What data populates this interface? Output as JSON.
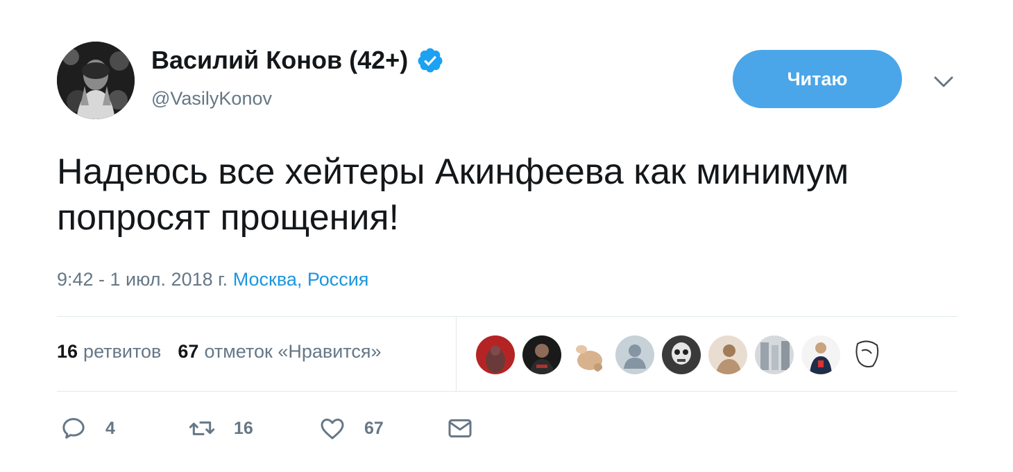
{
  "tweet": {
    "author_name": "Василий Конов (42+)",
    "author_handle": "@VasilyKonov",
    "follow_label": "Читаю",
    "text": "Надеюсь все хейтеры Акинфеева как минимум попросят прощения!",
    "timestamp": "9:42 - 1 июл. 2018 г.",
    "location": "Москва, Россия"
  },
  "stats": {
    "retweets_count": "16",
    "retweets_label": "ретвитов",
    "likes_count": "67",
    "likes_label": "отметок «Нравится»"
  },
  "actions": {
    "reply_count": "4",
    "retweet_count": "16",
    "like_count": "67"
  },
  "icons": {
    "verified": "verified-badge-icon",
    "caret": "chevron-down-icon",
    "reply": "reply-bubble-icon",
    "retweet": "retweet-arrows-icon",
    "like": "heart-icon",
    "dm": "envelope-icon"
  },
  "colors": {
    "accent": "#1b95e0",
    "follow_button": "#4aa6e9",
    "muted_text": "#657786",
    "divider": "#e1e8ed"
  }
}
